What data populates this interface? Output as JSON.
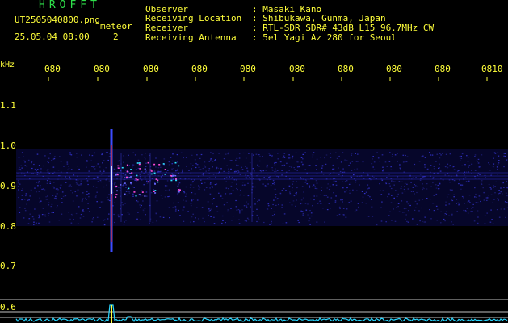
{
  "app": {
    "name": "HROFFT"
  },
  "file": {
    "name": "UT2505040800.png",
    "event": "meteor",
    "datetime": "25.05.04 08:00",
    "count": "2"
  },
  "header": [
    {
      "label": "Observer",
      "value": ": Masaki Kano"
    },
    {
      "label": "Receiving Location",
      "value": ": Shibukawa, Gunma, Japan"
    },
    {
      "label": "Receiver",
      "value": ": RTL-SDR SDR# 43dB L15 96.7MHz CW"
    },
    {
      "label": "Receiving Antenna",
      "value": ": 5el Yagi Az 280 for Seoul"
    }
  ],
  "time_axis": [
    "080",
    "080",
    "080",
    "080",
    "080",
    "080",
    "080",
    "080",
    "080",
    "0810"
  ],
  "freq_axis": {
    "unit": "kHz",
    "labels": [
      "1.1",
      "1.0",
      "0.9",
      "0.8",
      "0.7",
      "0.6"
    ]
  },
  "colors": {
    "text_green": "#2ee04a",
    "text_yellow": "#ffff3a",
    "background": "#000000",
    "noise_band": "#1a1a8c",
    "spectrum_trace": "#29d6ff",
    "meteor_head": "#ffffff"
  }
}
